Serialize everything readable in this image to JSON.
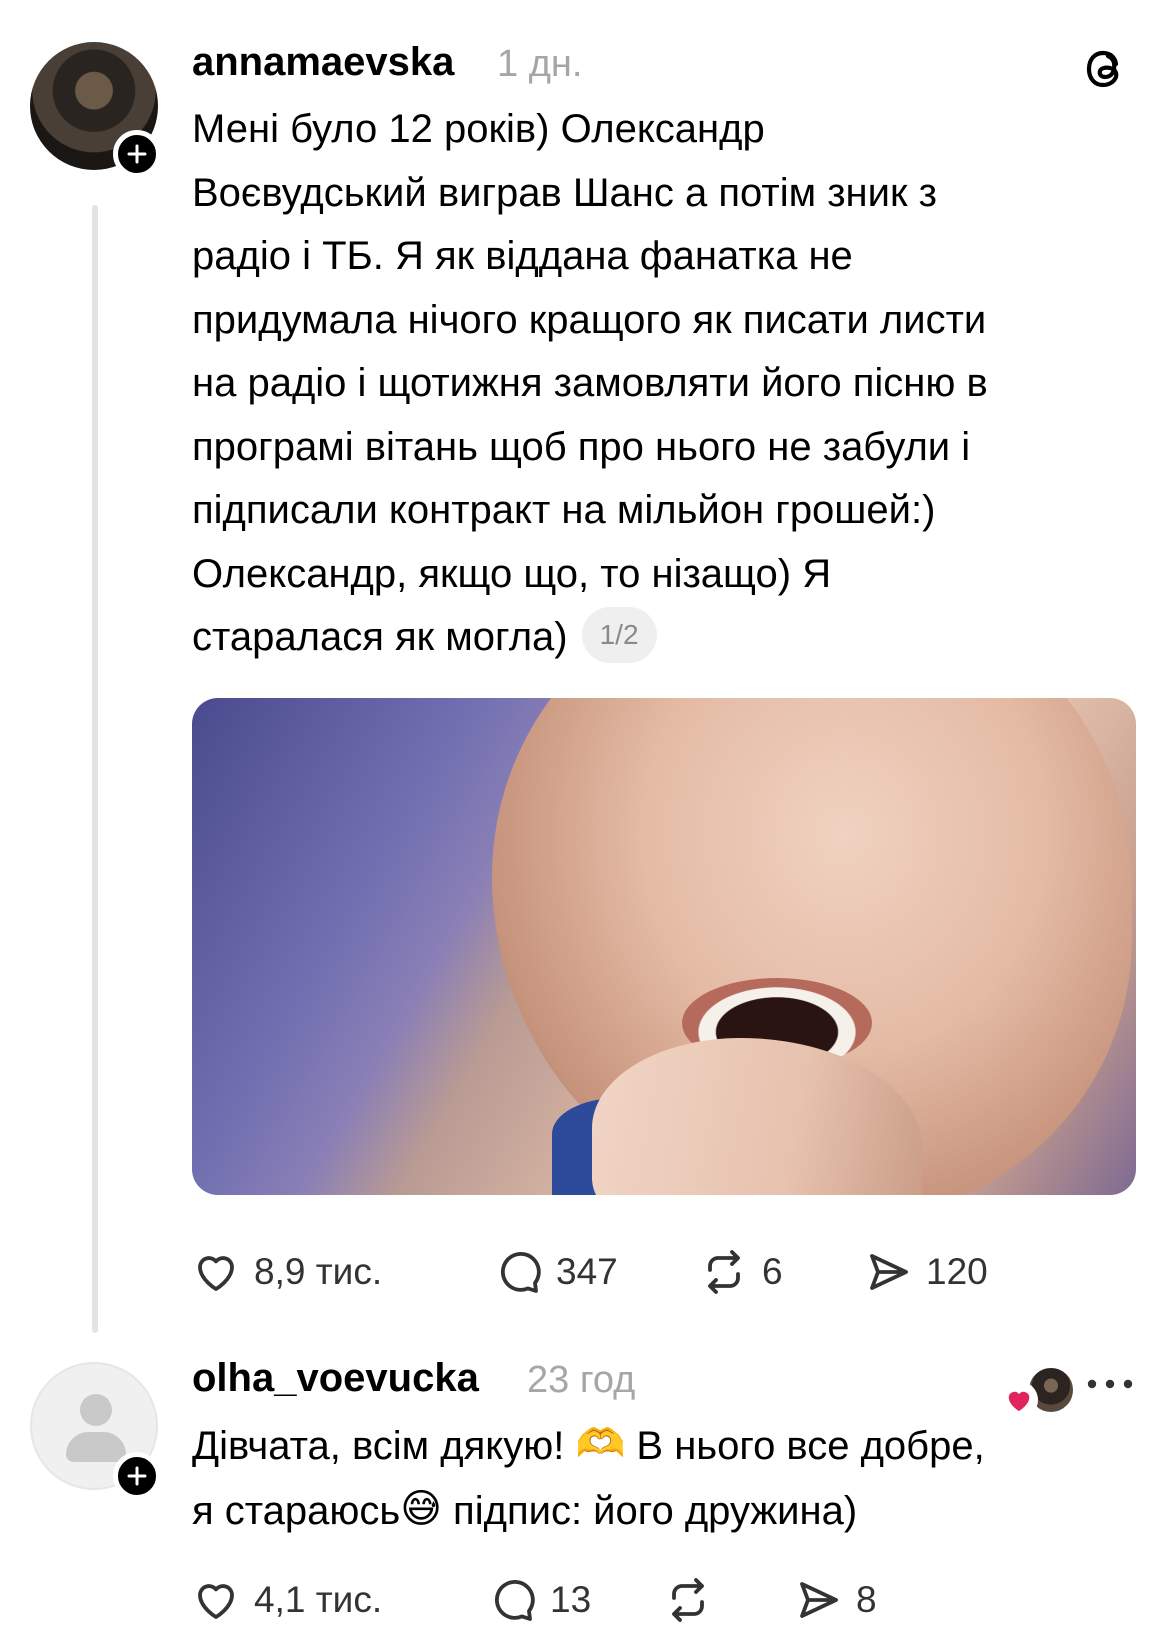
{
  "post": {
    "username": "annamaevska",
    "timestamp": "1 дн.",
    "text": "Мені було 12 років) Олександр\nВоєвудський виграв Шанс а потім зник з\nрадіо і ТБ. Я як віддана фанатка не\nпридумала нічого кращого як писати листи\nна радіо і щотижня замовляти його пісню в\nпрограмі вітань щоб про нього не забули і\nпідписали контракт на мільйон грошей:)\nОлександр, якщо що, то нізащо) Я\nстаралася як могла)",
    "page_indicator": "1/2",
    "actions": {
      "likes": "8,9 тис.",
      "replies": "347",
      "reposts": "6",
      "shares": "120"
    }
  },
  "reply": {
    "username": "olha_voevucka",
    "timestamp": "23 год",
    "text_part1": "Дівчата, всім дякую! ",
    "emoji1": "🫶",
    "text_part2": " В нього все добре,\nя стараюсь",
    "emoji2": "😅",
    "text_part3": " підпис: його дружина)",
    "actions": {
      "likes": "4,1 тис.",
      "replies": "13",
      "reposts": "",
      "shares": "8"
    }
  },
  "icons": {
    "threads_logo": "threads-logo-icon",
    "like": "heart-icon",
    "reply": "speech-bubble-icon",
    "repost": "repost-icon",
    "share": "send-icon",
    "follow": "plus-icon",
    "more": "more-horizontal-icon",
    "liked_by_author": "heart-badge-icon"
  },
  "colors": {
    "text": "#000000",
    "muted": "#a6a6a6",
    "icon": "#333333",
    "thread_line": "#e3e3e3",
    "heart_badge": "#e0245e"
  }
}
